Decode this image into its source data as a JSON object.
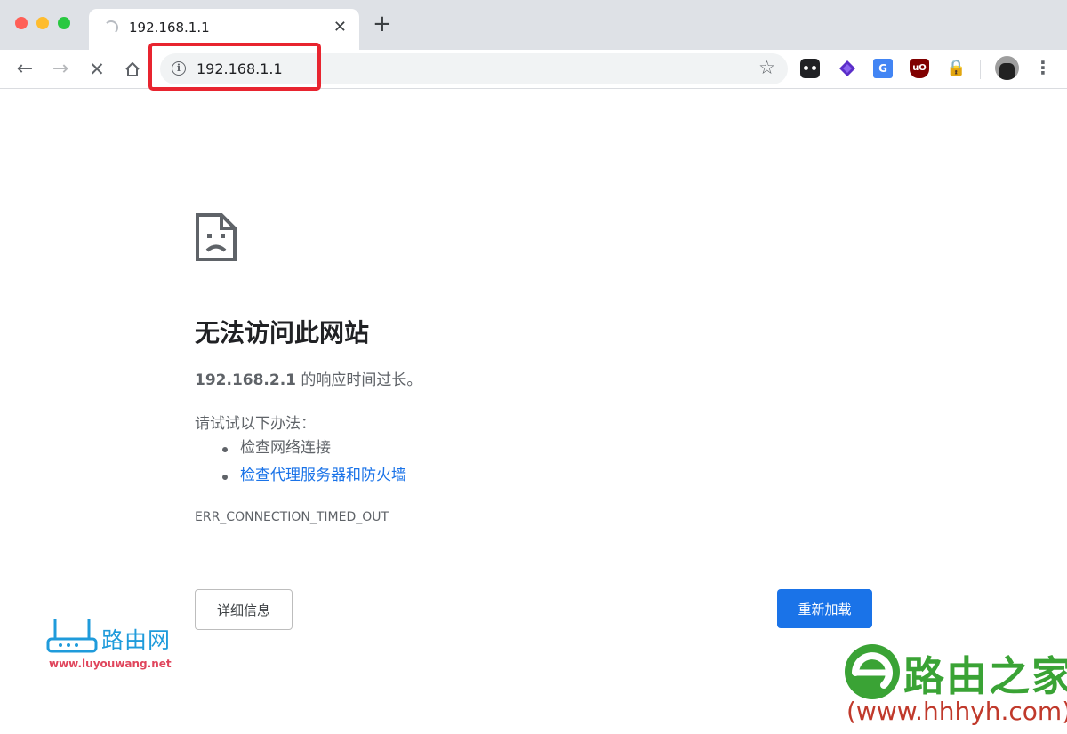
{
  "window": {
    "tab_title": "192.168.1.1"
  },
  "toolbar": {
    "url": "192.168.1.1",
    "extensions": [
      "dark-reader-ext",
      "layers-ext",
      "google-translate-ext",
      "ublock-ext",
      "lock-ext"
    ]
  },
  "error_page": {
    "heading": "无法访问此网站",
    "host": "192.168.2.1",
    "summary_suffix": " 的响应时间过长。",
    "try_intro": "请试试以下办法：",
    "suggestions": [
      "检查网络连接",
      "检查代理服务器和防火墙"
    ],
    "error_code": "ERR_CONNECTION_TIMED_OUT",
    "details_button": "详细信息",
    "reload_button": "重新加载"
  },
  "watermarks": {
    "left_brand": "路由网",
    "left_url": "www.luyouwang.net",
    "right_brand": "路由之家",
    "right_url": "(www.hhhyh.com)"
  },
  "colors": {
    "accent_blue": "#1a73e8",
    "highlight_red": "#e8242f",
    "watermark_green": "#3aa335"
  }
}
